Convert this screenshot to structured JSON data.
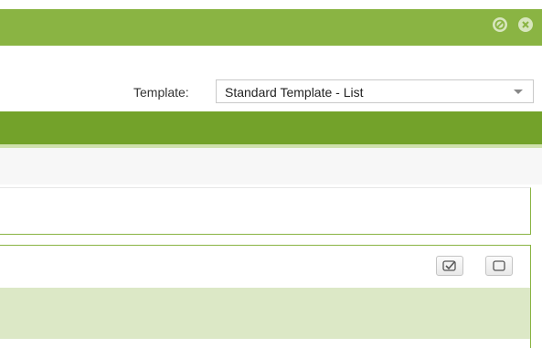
{
  "window": {
    "controls": [
      {
        "name": "minimize",
        "icon": "circle-minus-icon"
      },
      {
        "name": "close",
        "icon": "circle-x-icon"
      }
    ]
  },
  "template": {
    "label": "Template:",
    "selected_value": "Standard Template - List"
  },
  "toolbar": {
    "check_all_icon": "checked-box-icon",
    "uncheck_all_icon": "empty-box-icon"
  },
  "colors": {
    "titlebar": "#8ab443",
    "band": "#73a22a",
    "panel_border": "#8ab443",
    "panel_fill": "#dce8c6"
  }
}
